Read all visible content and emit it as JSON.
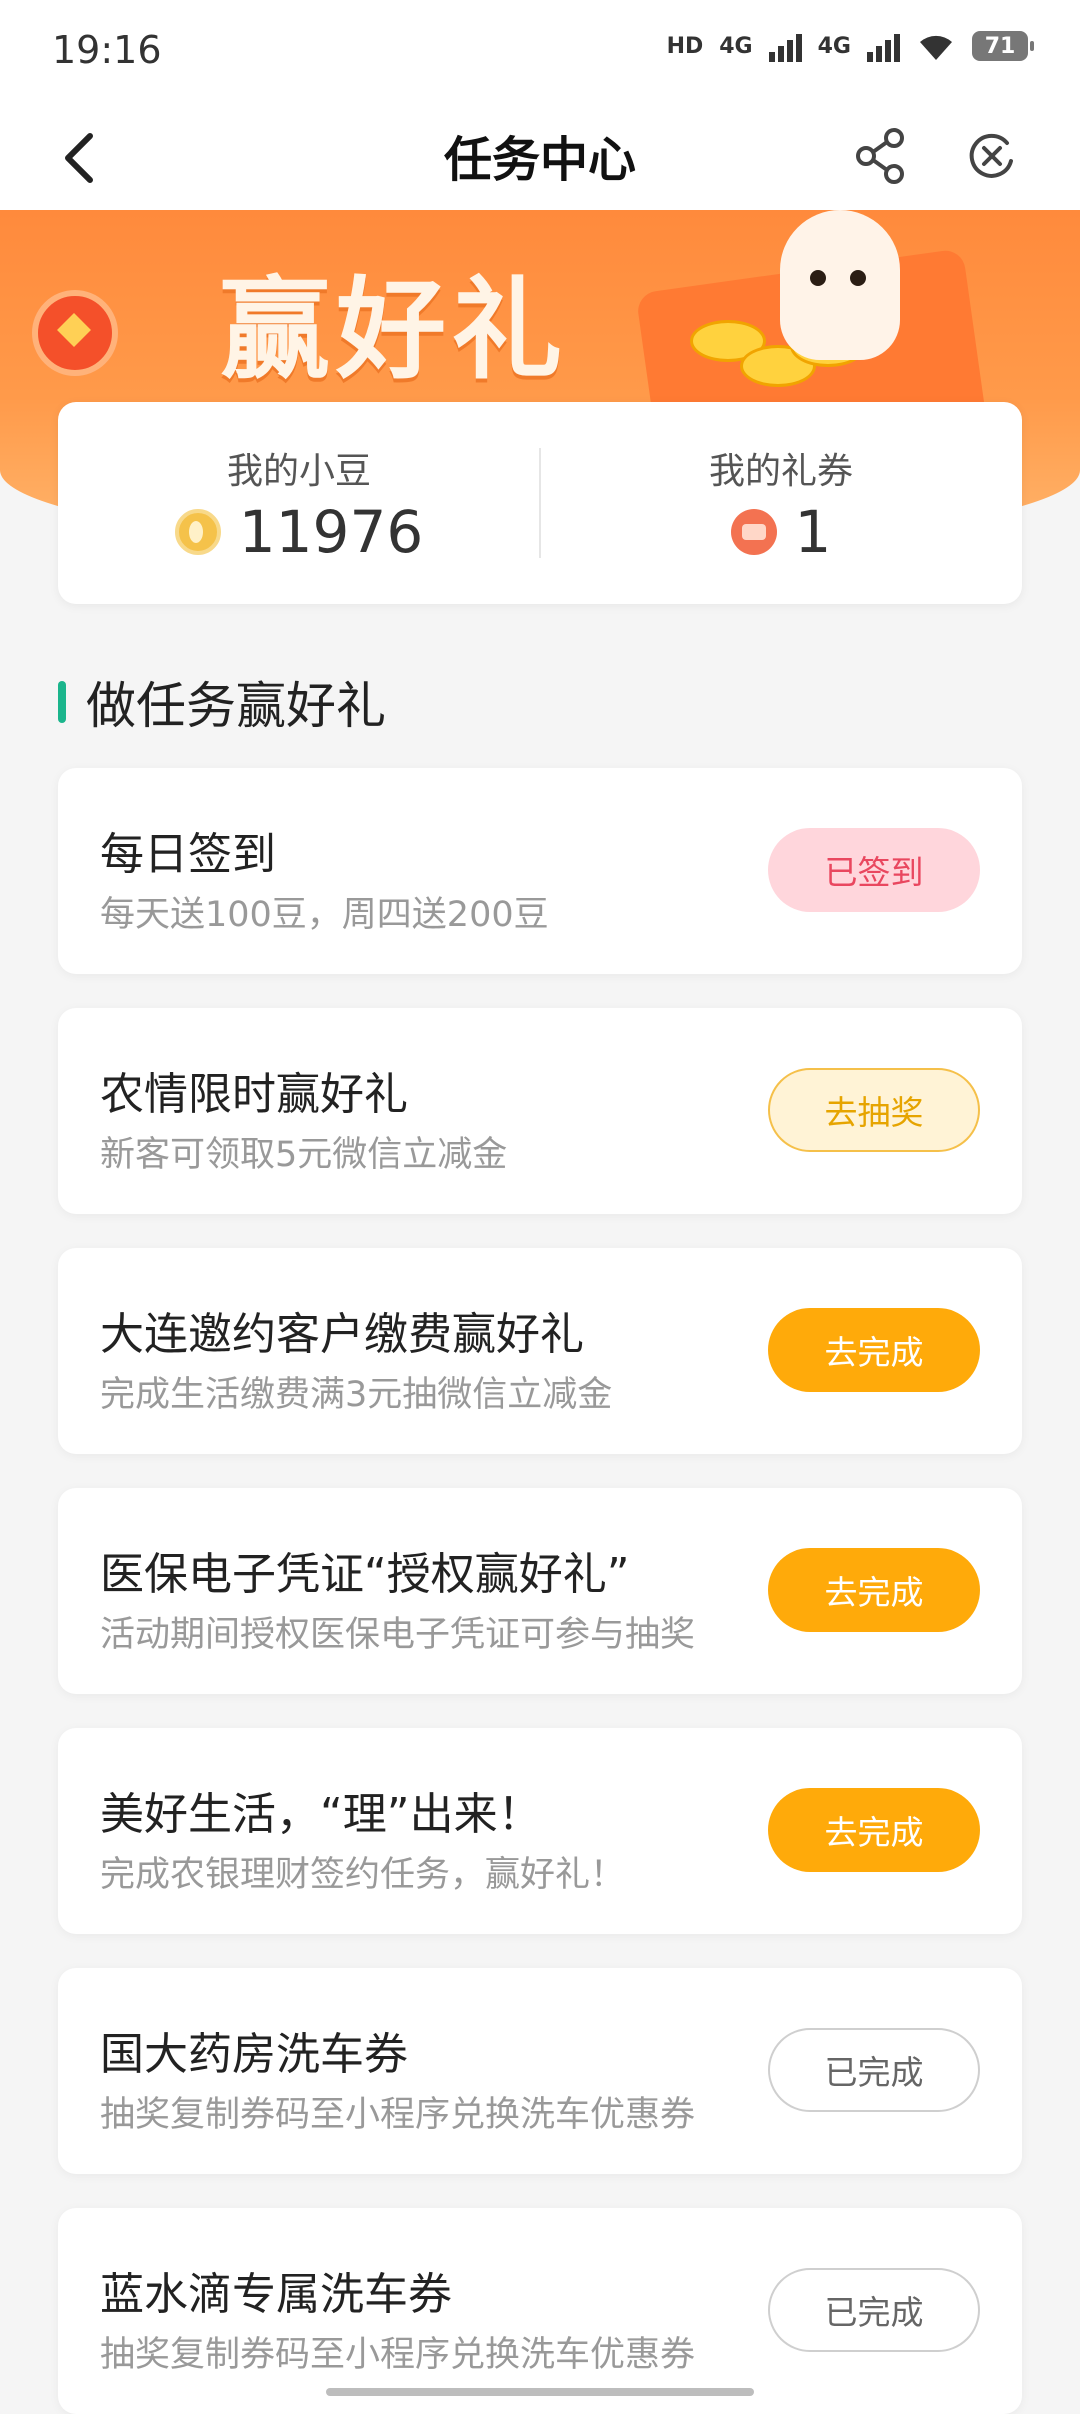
{
  "status_bar": {
    "time": "19:16",
    "hd_label": "HD",
    "net1": "4G",
    "net2": "4G",
    "battery": "71"
  },
  "nav": {
    "title": "任务中心",
    "back_icon": "chevron-left-icon",
    "share_icon": "share-icon",
    "close_icon": "close-circle-icon"
  },
  "banner": {
    "headline": "赢好礼",
    "colors": {
      "top": "#ff8a3c",
      "bottom": "#ffb66d"
    }
  },
  "stats": {
    "beans_label": "我的小豆",
    "beans_value": "11976",
    "coupons_label": "我的礼券",
    "coupons_value": "1"
  },
  "section": {
    "title": "做任务赢好礼",
    "accent": "#1bb58c"
  },
  "tasks": [
    {
      "title": "每日签到",
      "subtitle": "每天送100豆，周四送200豆",
      "button": "已签到",
      "state": "signed"
    },
    {
      "title": "农情限时赢好礼",
      "subtitle": "新客可领取5元微信立减金",
      "button": "去抽奖",
      "state": "lottery"
    },
    {
      "title": "大连邀约客户缴费赢好礼",
      "subtitle": "完成生活缴费满3元抽微信立减金",
      "button": "去完成",
      "state": "todo"
    },
    {
      "title": "医保电子凭证“授权赢好礼”",
      "subtitle": "活动期间授权医保电子凭证可参与抽奖",
      "button": "去完成",
      "state": "todo"
    },
    {
      "title": "美好生活，“理”出来！",
      "subtitle": "完成农银理财签约任务，赢好礼！",
      "button": "去完成",
      "state": "todo"
    },
    {
      "title": "国大药房洗车券",
      "subtitle": "抽奖复制券码至小程序兑换洗车优惠券",
      "button": "已完成",
      "state": "done"
    },
    {
      "title": "蓝水滴专属洗车券",
      "subtitle": "抽奖复制券码至小程序兑换洗车优惠券",
      "button": "已完成",
      "state": "done"
    }
  ]
}
